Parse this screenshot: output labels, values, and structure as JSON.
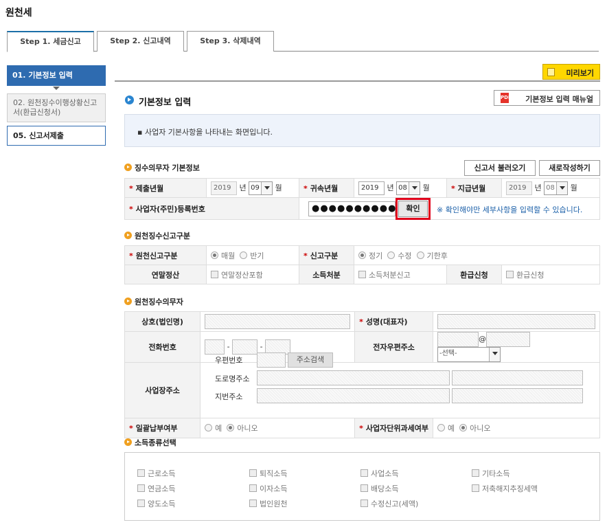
{
  "page_title": "원천세",
  "tabs": [
    "Step 1. 세금신고",
    "Step 2. 신고내역",
    "Step 3. 삭제내역"
  ],
  "steps": [
    "01. 기본정보 입력",
    "02. 원천징수이행상황신고서(환급신청서)",
    "05. 신고서제출"
  ],
  "preview_label": "미리보기",
  "section_title": "기본정보 입력",
  "manual_label": "기본정보 입력 매뉴얼",
  "pdf_icon_text": "PDF",
  "info_text": "▪ 사업자 기본사항을 나타내는 화면입니다.",
  "withholder": {
    "title": "징수의무자 기본정보",
    "load_btn": "신고서 불러오기",
    "new_btn": "새로작성하기",
    "submit_label": "제출년월",
    "submit_year": "2019",
    "submit_month": "09",
    "belong_label": "귀속년월",
    "belong_year": "2019",
    "belong_month": "08",
    "pay_label": "지급년월",
    "pay_year": "2019",
    "pay_month": "08",
    "year_unit": "년",
    "month_unit": "월",
    "regno_label": "사업자(주민)등록번호",
    "regno_value": "●●●●●●●●●●",
    "confirm_btn": "확인",
    "note": "※ 확인해야만 세부사항을 입력할 수 있습니다."
  },
  "report_type": {
    "title": "원천징수신고구분",
    "kind_label": "원천신고구분",
    "kind_options": [
      "매월",
      "반기"
    ],
    "report_label": "신고구분",
    "report_options": [
      "정기",
      "수정",
      "기한후"
    ],
    "yearend_label": "연말정산",
    "yearend_check": "연말정산포함",
    "income_label": "소득처분",
    "income_check": "소득처분신고",
    "refund_label": "환급신청",
    "refund_check": "환급신청"
  },
  "obligor": {
    "title": "원천징수의무자",
    "company_label": "상호(법인명)",
    "ceo_label": "성명(대표자)",
    "phone_label": "전화번호",
    "email_label": "전자우편주소",
    "email_select": "-선택-",
    "address_label": "사업장주소",
    "zip_label": "우편번호",
    "zip_btn": "주소검색",
    "road_label": "도로명주소",
    "lot_label": "지번주소",
    "bulk_label": "일괄납부여부",
    "unit_label": "사업자단위과세여부",
    "yes": "예",
    "no": "아니오"
  },
  "income_types": {
    "title": "소득종류선택",
    "items": [
      "근로소득",
      "퇴직소득",
      "사업소득",
      "기타소득",
      "연금소득",
      "이자소득",
      "배당소득",
      "저축해지추징세액",
      "양도소득",
      "법인원천",
      "수정신고(세액)"
    ]
  }
}
